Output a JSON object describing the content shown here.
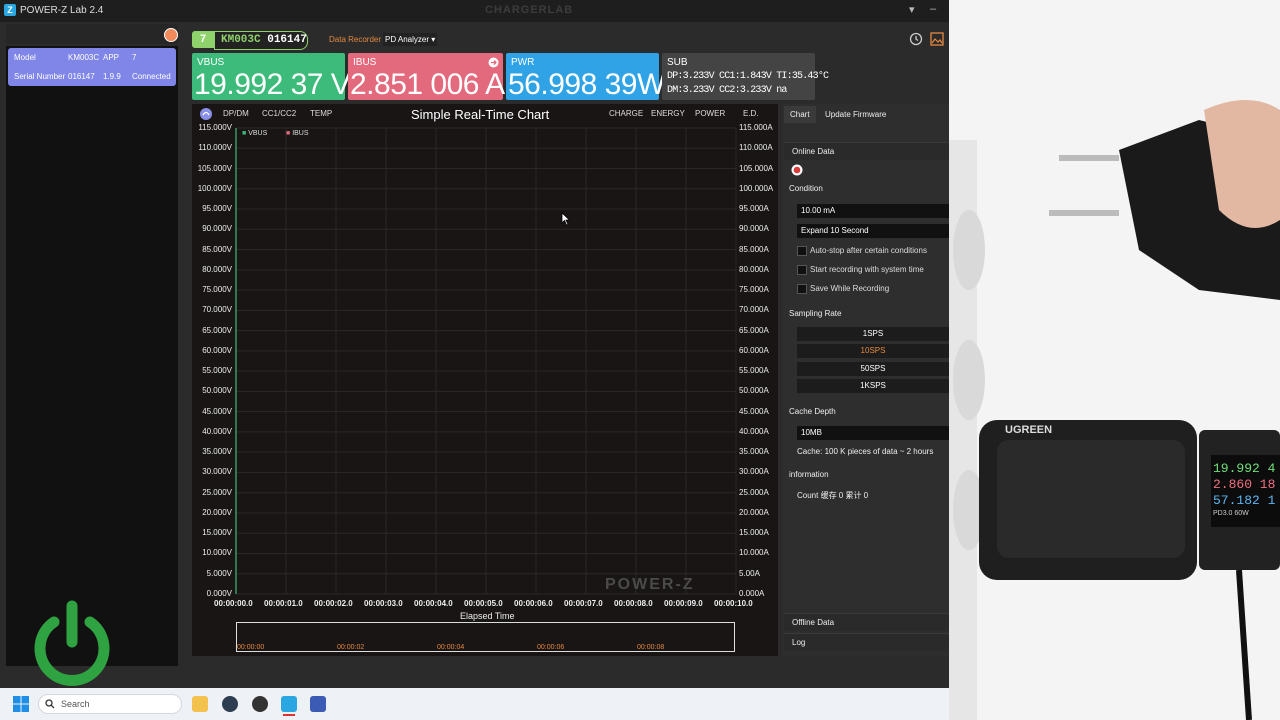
{
  "app": {
    "title": "POWER-Z Lab 2.4",
    "brand": "CHARGERLAB"
  },
  "device": {
    "model_label": "Model",
    "model": "KM003C",
    "app_label": "APP",
    "app_value": "7",
    "serial_label": "Serial Number",
    "serial": "016147",
    "version": "1.9.9",
    "status": "Connected"
  },
  "topbar": {
    "badge_num": "7",
    "badge_model": "KM003C",
    "badge_serial": "016147",
    "recorder_label": "Data Recorder",
    "analyzer_label": "PD Analyzer"
  },
  "meters": {
    "vbus": {
      "label": "VBUS",
      "value": "19.992 37 V",
      "color": "#3dbb7a"
    },
    "ibus": {
      "label": "IBUS",
      "value": "2.851 006 A",
      "color": "#e3697c"
    },
    "pwr": {
      "label": "PWR",
      "value": "56.998 39W",
      "color": "#2fa3e6"
    },
    "sub": {
      "label": "SUB",
      "line1": "DP:3.233V  CC1:1.843V  TI:35.43°C",
      "line2": "DM:3.233V  CC2:3.233V na",
      "color": "#444444"
    }
  },
  "chart_toolbar": {
    "left": [
      "DP/DM",
      "CC1/CC2",
      "TEMP"
    ],
    "right": [
      "CHARGE",
      "ENERGY",
      "POWER",
      "E.D."
    ]
  },
  "chart_data": {
    "type": "line",
    "title": "Simple Real-Time Chart",
    "xlabel": "Elapsed Time",
    "x_ticks": [
      "00:00:00.0",
      "00:00:01.0",
      "00:00:02.0",
      "00:00:03.0",
      "00:00:04.0",
      "00:00:05.0",
      "00:00:06.0",
      "00:00:07.0",
      "00:00:08.0",
      "00:00:09.0",
      "00:00:10.0"
    ],
    "y_left_ticks": [
      "115.000V",
      "110.000V",
      "105.000V",
      "100.000V",
      "95.000V",
      "90.000V",
      "85.000V",
      "80.000V",
      "75.000V",
      "70.000V",
      "65.000V",
      "60.000V",
      "55.000V",
      "50.000V",
      "45.000V",
      "40.000V",
      "35.000V",
      "30.000V",
      "25.000V",
      "20.000V",
      "15.000V",
      "10.000V",
      "5.000V",
      "0.000V"
    ],
    "y_right_ticks": [
      "115.000A",
      "110.000A",
      "105.000A",
      "100.000A",
      "95.000A",
      "90.000A",
      "85.000A",
      "80.000A",
      "75.000A",
      "70.000A",
      "65.000A",
      "60.000A",
      "55.000A",
      "50.000A",
      "45.000A",
      "40.000A",
      "35.000A",
      "30.000A",
      "25.000A",
      "20.000A",
      "15.000A",
      "10.000A",
      "5.00A",
      "0.000A"
    ],
    "ylim": [
      0,
      115
    ],
    "xlim": [
      0,
      10
    ],
    "series": [
      {
        "name": "VBUS",
        "color": "#3dbb7a",
        "values": []
      },
      {
        "name": "IBUS",
        "color": "#e3697c",
        "values": []
      }
    ],
    "watermark": "POWER-Z",
    "overview_ticks": [
      "00:00:00",
      "00:00:02",
      "00:00:04",
      "00:00:06",
      "00:00:08"
    ]
  },
  "right_panel": {
    "tabs": [
      "Chart",
      "Update Firmware"
    ],
    "online_data": "Online Data",
    "condition_label": "Condition",
    "condition_value": "10.00 mA",
    "expand_value": "Expand 10 Second",
    "options": [
      "Auto-stop after certain conditions",
      "Start recording with system time",
      "Save While Recording"
    ],
    "sampling_label": "Sampling Rate",
    "rates": [
      "1SPS",
      "10SPS",
      "50SPS",
      "1KSPS"
    ],
    "selected_rate_color": "#e5883e",
    "cache_label": "Cache Depth",
    "cache_value": "10MB",
    "cache_info": "Cache: 100 K pieces of data  ~ 2 hours",
    "info_label": "information",
    "count_text": "Count 缓存 0 累计 0",
    "offline_data": "Offline Data",
    "log": "Log"
  },
  "taskbar": {
    "search_placeholder": "Search"
  },
  "photo": {
    "charger_brand": "UGREEN",
    "meter_v": "19.992 4",
    "meter_a": "2.860 18",
    "meter_w": "57.182 1",
    "meter_mode": "PD3.0 60W"
  }
}
